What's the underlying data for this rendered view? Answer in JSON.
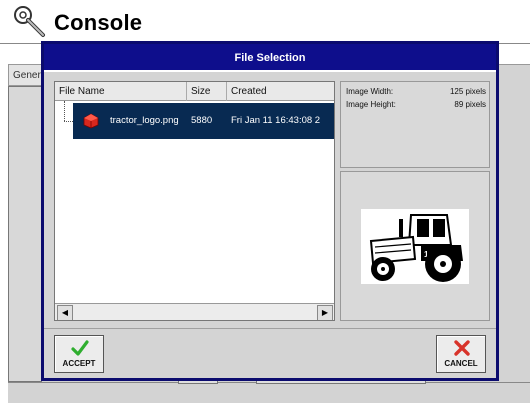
{
  "console": {
    "title": "Console",
    "tab_label": "General"
  },
  "dialog": {
    "title": "File Selection",
    "columns": [
      "File Name",
      "Size",
      "Created"
    ],
    "files": [
      {
        "name": "tractor_logo.png",
        "size": "5880",
        "created": "Fri Jan 11 16:43:08 2"
      }
    ],
    "info": {
      "width_label": "Image Width:",
      "width_value": "125 pixels",
      "height_label": "Image Height:",
      "height_value": "89 pixels"
    },
    "buttons": {
      "accept": "ACCEPT",
      "cancel": "CANCEL"
    }
  },
  "colors": {
    "dialog_border": "#0b0b6e",
    "title_bar": "#0e0e8c",
    "selection": "#082a52",
    "accept_icon": "#2fae2f",
    "cancel_icon": "#d8332a"
  },
  "icons": [
    "wrench-icon",
    "file-png-icon",
    "checkmark-icon",
    "x-icon",
    "scroll-left-icon",
    "scroll-right-icon"
  ]
}
